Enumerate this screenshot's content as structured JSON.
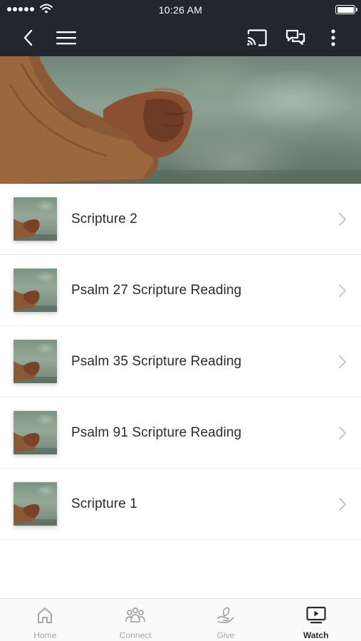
{
  "status_bar": {
    "time": "10:26 AM"
  },
  "nav": {
    "icons": [
      "chevron-left-icon",
      "hamburger-menu-icon",
      "cast-icon",
      "chat-icon",
      "more-vertical-icon"
    ]
  },
  "list": {
    "items": [
      {
        "title": "Scripture 2"
      },
      {
        "title": "Psalm 27 Scripture Reading"
      },
      {
        "title": "Psalm 35 Scripture Reading"
      },
      {
        "title": "Psalm 91 Scripture Reading"
      },
      {
        "title": "Scripture 1"
      }
    ]
  },
  "tabs": [
    {
      "label": "Home",
      "icon": "home-icon",
      "active": false
    },
    {
      "label": "Connect",
      "icon": "people-icon",
      "active": false
    },
    {
      "label": "Give",
      "icon": "give-leaf-hand-icon",
      "active": false
    },
    {
      "label": "Watch",
      "icon": "play-screen-icon",
      "active": true
    }
  ],
  "colors": {
    "chrome": "#23262d",
    "tab_active": "#2b2b2b",
    "tab_inactive": "#a7a7a7",
    "divider": "#e9e9e9"
  }
}
